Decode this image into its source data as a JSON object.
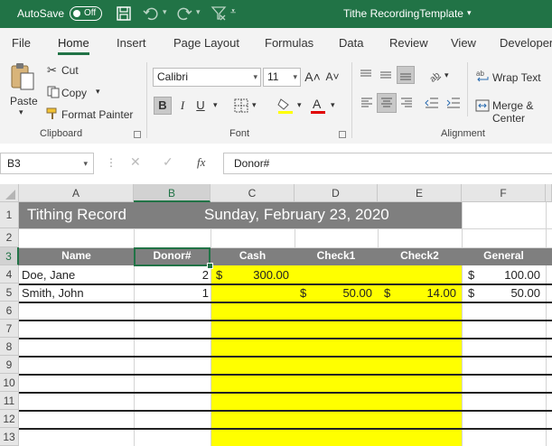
{
  "titlebar": {
    "autosave_label": "AutoSave",
    "autosave_state": "Off",
    "doc_title": "Tithe RecordingTemplate",
    "title_caret": "▾",
    "accent": "#217346"
  },
  "menu": {
    "tabs": [
      "File",
      "Home",
      "Insert",
      "Page Layout",
      "Formulas",
      "Data",
      "Review",
      "View",
      "Developer"
    ],
    "active": "Home"
  },
  "ribbon": {
    "clipboard": {
      "paste": "Paste",
      "cut": "Cut",
      "copy": "Copy",
      "format_painter": "Format Painter",
      "label": "Clipboard"
    },
    "font": {
      "name": "Calibri",
      "size": "11",
      "bold": "B",
      "italic": "I",
      "underline": "U",
      "grow": "A˄",
      "shrink": "A˅",
      "label": "Font"
    },
    "alignment": {
      "wrap_text": "Wrap Text",
      "merge": "Merge & Center",
      "label": "Alignment"
    }
  },
  "formula_bar": {
    "name_box": "B3",
    "fx": "fx",
    "content": "Donor#"
  },
  "sheet": {
    "columns": [
      "A",
      "B",
      "C",
      "D",
      "E",
      "F"
    ],
    "selected_column": "B",
    "rows": [
      "1",
      "2",
      "3",
      "4",
      "5",
      "6",
      "7",
      "8",
      "9",
      "10",
      "11",
      "12",
      "13"
    ],
    "selected_row": "3",
    "title": "Tithing Record",
    "date": "Sunday, February 23, 2020",
    "headers": [
      "Name",
      "Donor#",
      "Cash",
      "Check1",
      "Check2",
      "General"
    ],
    "records": [
      {
        "name": "Doe, Jane",
        "donor": "2",
        "cash": "300.00",
        "check1": "",
        "check2": "",
        "general": "100.00"
      },
      {
        "name": "Smith, John",
        "donor": "1",
        "cash": "",
        "check1": "50.00",
        "check2": "14.00",
        "general": "50.00"
      }
    ],
    "currency": "$",
    "fill_color": "#ffff00",
    "header_color": "#7f7f7f"
  }
}
